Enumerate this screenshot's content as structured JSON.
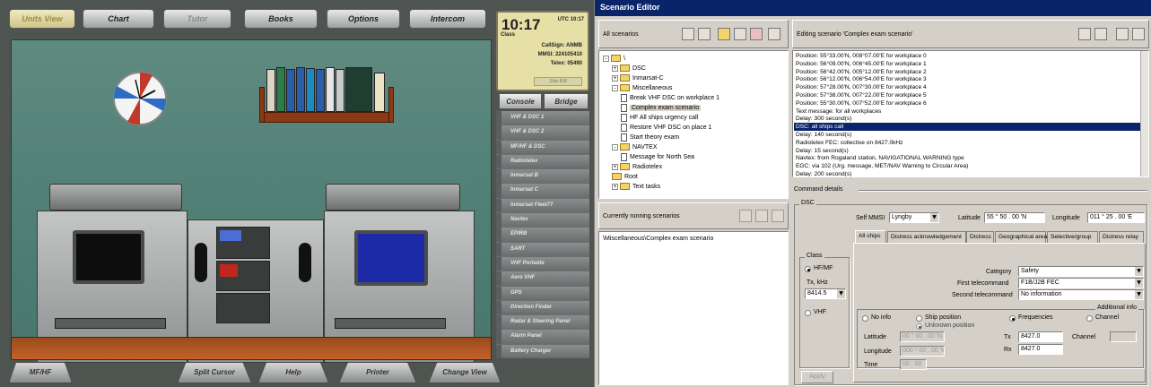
{
  "simulator": {
    "top_buttons": [
      "Units View",
      "Chart",
      "Tutor",
      "Books",
      "Options",
      "Intercom"
    ],
    "clock": {
      "time": "10:17",
      "utc": "UTC 10:17",
      "class": "Class",
      "callsign": "CallSign: ANMB",
      "mmsi": "MMSI: 224105410",
      "telex": "Telex: 05490",
      "ship_id": "Ship IDB"
    },
    "side_tabs": [
      "Console",
      "Bridge"
    ],
    "side_items": [
      "VHF & DSC 1",
      "VHF & DSC 2",
      "MF/HF & DSC",
      "Radiotelex",
      "Inmarsat B",
      "Inmarsat C",
      "Inmarsat Fleet77",
      "Navtex",
      "EPIRB",
      "SART",
      "VHF Portable",
      "Aero VHF",
      "GPS",
      "Direction Finder",
      "Radar & Steering Panel",
      "Alarm Panel",
      "Battery Charger"
    ],
    "bottom_buttons": [
      "MF/HF",
      "Split Cursor",
      "Help",
      "Printer",
      "Change View"
    ]
  },
  "editor": {
    "title": "Scenario Editor",
    "all_scenarios_label": "All scenarios",
    "editing_label": "Editing scenario 'Complex exam scenario'",
    "tree": [
      {
        "label": "\\",
        "type": "folder",
        "indent": 0,
        "exp": "-"
      },
      {
        "label": "DSC",
        "type": "folder",
        "indent": 1,
        "exp": "+"
      },
      {
        "label": "Inmarsat-C",
        "type": "folder",
        "indent": 1,
        "exp": "+"
      },
      {
        "label": "Miscellaneous",
        "type": "folder",
        "indent": 1,
        "exp": "-"
      },
      {
        "label": "Break VHF DSC on workplace 1",
        "type": "doc",
        "indent": 2,
        "exp": ""
      },
      {
        "label": "Complex exam scenario",
        "type": "doc",
        "indent": 2,
        "exp": ""
      },
      {
        "label": "HF All ships urgency call",
        "type": "doc",
        "indent": 2,
        "exp": ""
      },
      {
        "label": "Restore VHF DSC on place 1",
        "type": "doc",
        "indent": 2,
        "exp": ""
      },
      {
        "label": "Start theory exam",
        "type": "doc",
        "indent": 2,
        "exp": ""
      },
      {
        "label": "NAVTEX",
        "type": "folder",
        "indent": 1,
        "exp": "-"
      },
      {
        "label": "Message for North Sea",
        "type": "doc",
        "indent": 2,
        "exp": ""
      },
      {
        "label": "Radiotelex",
        "type": "folder",
        "indent": 1,
        "exp": "+"
      },
      {
        "label": "Root",
        "type": "folder",
        "indent": 1,
        "exp": ""
      },
      {
        "label": "Text tasks",
        "type": "folder",
        "indent": 1,
        "exp": "+"
      }
    ],
    "running_label": "Currently running scenarios",
    "running_item": "\\Miscellaneous\\Complex exam scenario",
    "commands": [
      "Position: 55°33.00'N, 008°07.00'E for workplace 0",
      "Position: 56°09.00'N, 006°45.00'E for workplace 1",
      "Position: 56°42.00'N, 005°12.00'E for workplace 2",
      "Position: 56°12.00'N, 006°54.00'E for workplace 3",
      "Position: 57°28.00'N, 007°30.00'E for workplace 4",
      "Position: 57°38.00'N, 007°22.00'E for workplace 5",
      "Position: 55°30.00'N, 007°52.00'E for workplace 6",
      "Text message: for all workplaces",
      "Delay: 300 second(s)",
      "DSC: all ships call",
      "Delay: 140 second(s)",
      "Radiotelex FEC: collective on 8427.0kHz",
      "Delay: 15 second(s)",
      "Navtex: from Rogaland station, NAVIGATIONAL WARNING type",
      "EGC: via 102 (Urg. message, MET/NAV Warning to Circular Area)",
      "Delay: 200 second(s)"
    ],
    "selected_command": 9,
    "command_details_label": "Command details",
    "dsc": {
      "group_label": "DSC",
      "self_mmsi_label": "Self MMSI",
      "self_mmsi": "Lyngby",
      "latitude_label": "Latitude",
      "latitude": "55 ° 50 . 00 'N",
      "longitude_label": "Longitude",
      "longitude": "011 ° 25 . 00 'E",
      "tabs": [
        "All ships",
        "Distress acknowledgement",
        "Distress",
        "Geographical area",
        "Selective/group",
        "Distress relay"
      ],
      "class_label": "Class",
      "hfmf_label": "HF/MF",
      "tx_khz_label": "Tx, kHz",
      "tx_khz": "8414.5",
      "vhf_label": "VHF",
      "category_label": "Category",
      "category": "Safety",
      "first_tc_label": "First telecommand",
      "first_tc": "F1B/J2B FEC",
      "second_tc_label": "Second telecommand",
      "second_tc": "No information",
      "additional_info_label": "Additional info",
      "no_info_label": "No info",
      "ship_position_label": "Ship position",
      "unknown_position_label": "Unknown position",
      "frequencies_label": "Frequencies",
      "channel_radio_label": "Channel",
      "lat_label": "Latitude",
      "lat_val": "00 ° 00 . 00 'N",
      "lon_label": "Longitude",
      "lon_val": "000 ° 00 . 00 'W",
      "time_label": "Time",
      "time_val": "00 : 00",
      "tx_label": "Tx",
      "tx_val": "8427.0",
      "rx_label": "Rx",
      "rx_val": "8427.0",
      "channel_label": "Channel",
      "apply_label": "Apply"
    }
  }
}
